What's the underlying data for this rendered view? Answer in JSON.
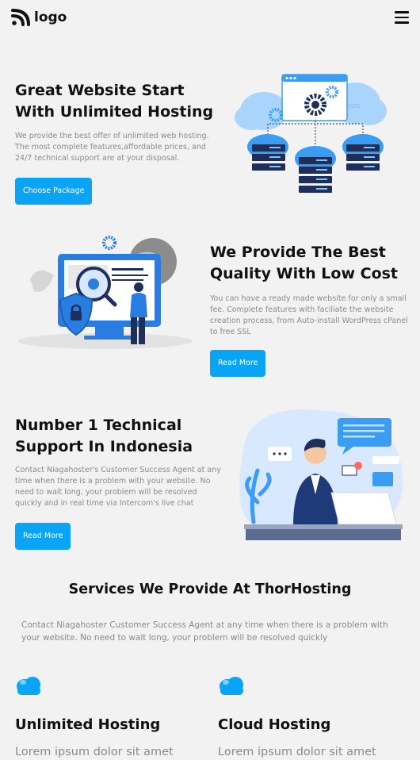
{
  "header": {
    "logo_text": "logo",
    "logo_icon": "rss-icon",
    "menu_icon": "hamburger-menu-icon"
  },
  "colors": {
    "accent": "#0aa4f6",
    "background": "#f2f2f2",
    "text_dark": "#111111",
    "text_muted": "#8a8a8a",
    "illustration_blue": "#3a9cf2",
    "illustration_navy": "#1e2f5a"
  },
  "hero": {
    "title_line1": "Great Website Start",
    "title_line2": "With Unlimited Hosting",
    "desc_line1": "We provide the best offer of unlimited web hosting.",
    "desc_line2": "The most complete features,affordable prices, and",
    "desc_line3": "24/7 technical support are at your disposal.",
    "button_label": "Choose Package"
  },
  "feature2": {
    "title_line1": "We Provide The Best",
    "title_line2": "Quality With Low Cost",
    "desc_line1": "You can have a ready made website for only a small",
    "desc_line2": "fee. Complete features with faciliate the website",
    "desc_line3": "creation process, from Auto-install WordPress cPanel",
    "desc_line4": "to free SSL",
    "button_label": "Read More"
  },
  "feature3": {
    "title_line1": "Number 1 Technical",
    "title_line2": "Support In Indonesia",
    "desc_line1": "Contact Niagahoster's Customer Success Agent at any",
    "desc_line2": "time when there is a problem with your website. No",
    "desc_line3": "need to wait long, your problem will be resolved",
    "desc_line4": "quickly and in real time via Intercom's live chat",
    "button_label": "Read More"
  },
  "services": {
    "title": "Services We Provide At ThorHosting",
    "desc_line1": "Contact Niagahoster Customer Success Agent at any time when there is a problem with",
    "desc_line2": "your website. No need to wait long, your problem will be resolved quickly",
    "items": [
      {
        "icon": "cloud-icon",
        "title": "Unlimited Hosting",
        "text": "Lorem ipsum dolor sit amet"
      },
      {
        "icon": "cloud-icon",
        "title": "Cloud Hosting",
        "text": "Lorem ipsum dolor sit amet"
      }
    ]
  }
}
